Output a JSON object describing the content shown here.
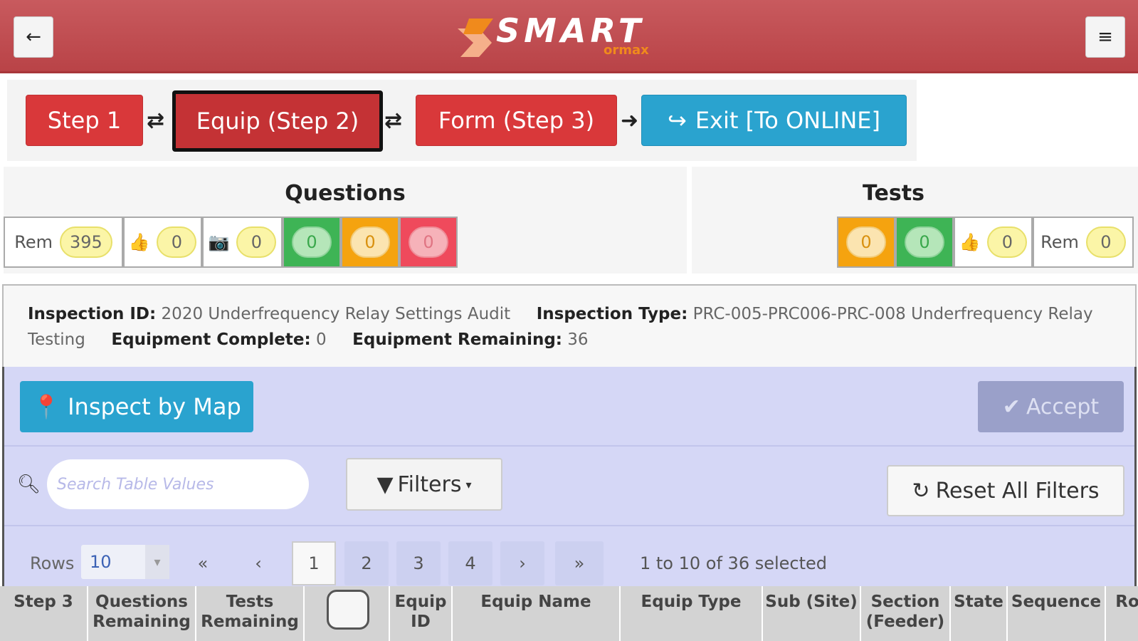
{
  "header": {
    "logo_text": "SMART",
    "logo_sub": "ormax"
  },
  "steps": {
    "step1": "Step 1",
    "step2": "Equip (Step 2)",
    "step3": "Form (Step 3)",
    "exit": "Exit [To ONLINE]",
    "sep1": "⇄",
    "sep2": "⇄",
    "arrow": "➜"
  },
  "questions": {
    "title": "Questions",
    "rem_label": "Rem",
    "rem": "395",
    "thumbs": "0",
    "camera": "0",
    "green": "0",
    "orange": "0",
    "red": "0"
  },
  "tests": {
    "title": "Tests",
    "orange": "0",
    "green": "0",
    "thumbs": "0",
    "rem_label": "Rem",
    "rem": "0"
  },
  "info": {
    "inspection_id_label": "Inspection ID:",
    "inspection_id": "2020 Underfrequency Relay Settings Audit",
    "inspection_type_label": "Inspection Type:",
    "inspection_type": "PRC-005-PRC006-PRC-008 Underfrequency Relay Testing",
    "equip_complete_label": "Equipment Complete:",
    "equip_complete": "0",
    "equip_remaining_label": "Equipment Remaining:",
    "equip_remaining": "36"
  },
  "toolbar": {
    "inspect_by_map": "Inspect by Map",
    "accept": "Accept",
    "search_placeholder": "Search Table Values",
    "filters": "Filters",
    "reset": "Reset All Filters"
  },
  "pagination": {
    "rows_label": "Rows",
    "rows_value": "10",
    "first": "«",
    "prev": "‹",
    "pages": [
      "1",
      "2",
      "3",
      "4"
    ],
    "next": "›",
    "last": "»",
    "summary": "1 to 10 of 36 selected"
  },
  "table": {
    "headers": [
      "Step 3",
      "Questions Remaining",
      "Tests Remaining",
      "",
      "Equip ID",
      "Equip Name",
      "Equip Type",
      "Sub (Site)",
      "Section (Feeder)",
      "State",
      "Sequence",
      "Ro"
    ]
  },
  "colors": {
    "header_red": "#b94347",
    "step_red": "#d9383a",
    "exit_blue": "#2aa3cf",
    "lavender": "#d5d7f6"
  }
}
